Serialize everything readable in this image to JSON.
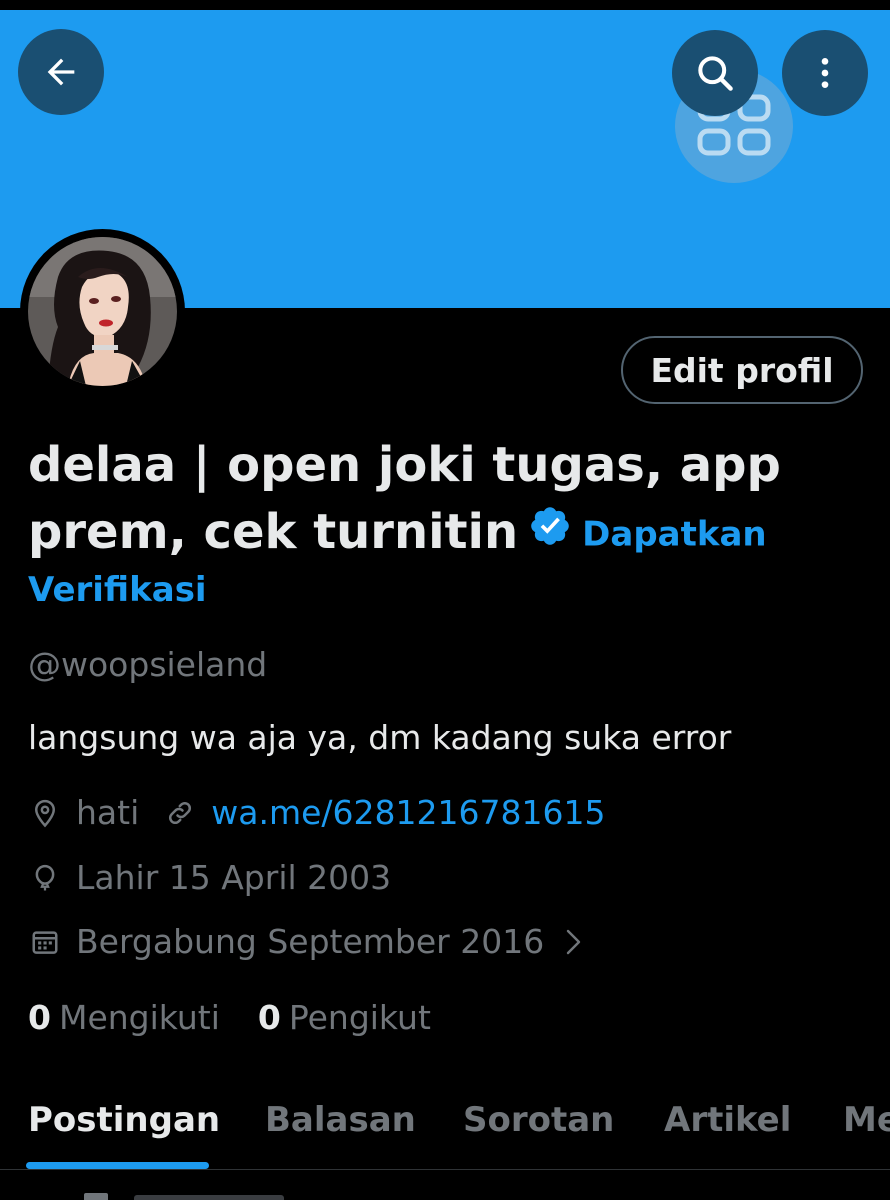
{
  "header": {
    "back_icon": "arrow-left-icon",
    "search_icon": "search-icon",
    "more_icon": "more-vertical-icon",
    "overlay_icon": "grid-icon"
  },
  "colors": {
    "banner": "#1d9bf0",
    "accent": "#1d9bf0",
    "background": "#000000",
    "muted": "#71767b"
  },
  "profile": {
    "edit_button": "Edit profil",
    "display_name": "delaa | open joki tugas, app prem, cek turnitin",
    "verified_icon": "verified-badge-icon",
    "get_verified_part1": "Dapatkan",
    "get_verified_part2": "Verifikasi",
    "handle": "@woopsieland",
    "bio": "langsung wa aja ya, dm kadang suka error",
    "location": "hati",
    "website": "wa.me/6281216781615",
    "birthday": "Lahir 15 April 2003",
    "joined": "Bergabung September 2016",
    "following_count": "0",
    "following_label": "Mengikuti",
    "followers_count": "0",
    "followers_label": "Pengikut"
  },
  "tabs": [
    {
      "label": "Postingan",
      "active": true
    },
    {
      "label": "Balasan",
      "active": false
    },
    {
      "label": "Sorotan",
      "active": false
    },
    {
      "label": "Artikel",
      "active": false
    },
    {
      "label": "Me",
      "active": false
    }
  ]
}
